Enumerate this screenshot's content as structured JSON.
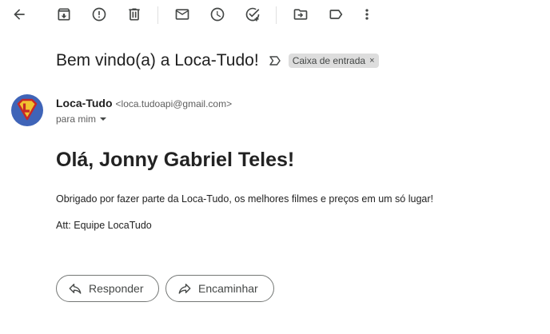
{
  "toolbar": {
    "icons": [
      "back-arrow-icon",
      "archive-icon",
      "report-spam-icon",
      "delete-icon",
      "mark-unread-icon",
      "snooze-icon",
      "add-task-icon",
      "move-to-icon",
      "label-icon",
      "more-options-icon"
    ]
  },
  "email": {
    "subject": "Bem vindo(a) a Loca-Tudo!",
    "label": "Caixa de entrada",
    "label_close": "×",
    "sender_name": "Loca-Tudo",
    "sender_email": "<loca.tudoapi@gmail.com>",
    "recipient": "para mim",
    "greeting": "Olá, Jonny Gabriel Teles!",
    "paragraph": "Obrigado por fazer parte da Loca-Tudo, os melhores filmes e preços em um só lugar!",
    "signature": "Att: Equipe LocaTudo"
  },
  "actions": {
    "reply_label": "Responder",
    "forward_label": "Encaminhar"
  },
  "colors": {
    "avatar_bg": "#3f64b8",
    "chip_bg": "#dddddd",
    "text": "#202124"
  }
}
